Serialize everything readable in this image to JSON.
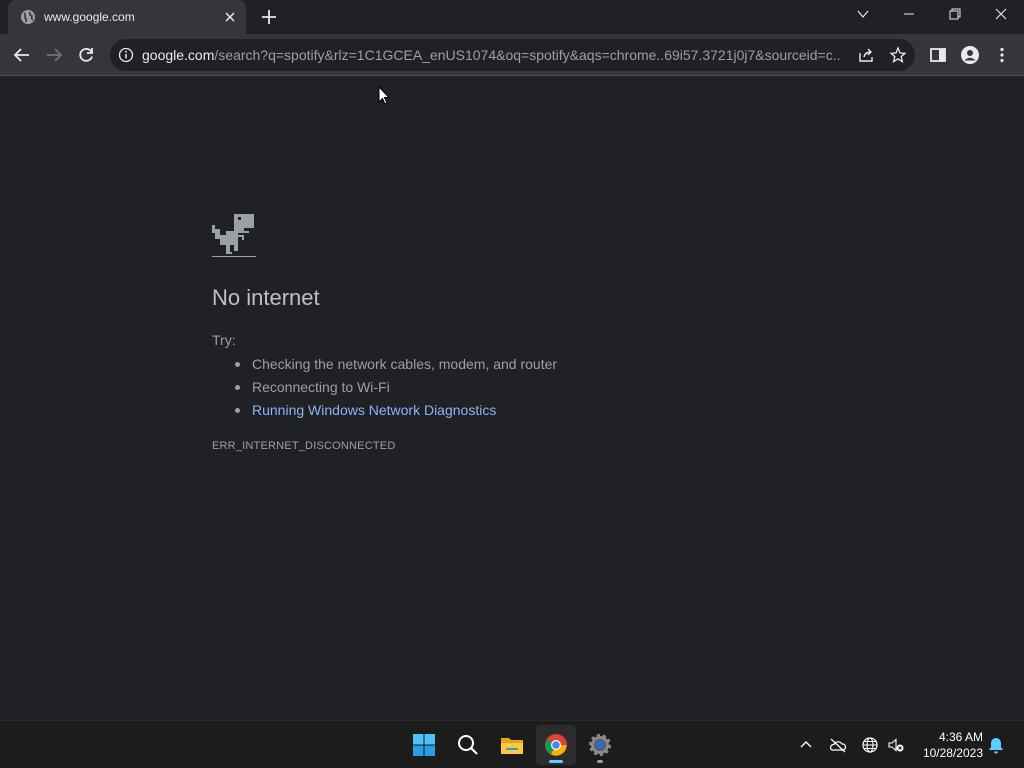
{
  "browser": {
    "tab": {
      "title": "www.google.com"
    },
    "address_bar": {
      "host": "google.com",
      "path": "/search?q=spotify&rlz=1C1GCEA_enUS1074&oq=spotify&aqs=chrome..69i57.3721j0j7&sourceid=c..."
    }
  },
  "error_page": {
    "heading": "No internet",
    "try_label": "Try:",
    "suggestions": [
      "Checking the network cables, modem, and router",
      "Reconnecting to Wi-Fi",
      "Running Windows Network Diagnostics"
    ],
    "error_code": "ERR_INTERNET_DISCONNECTED"
  },
  "taskbar": {
    "apps": [
      "start-icon",
      "search-icon",
      "file-explorer-icon",
      "chrome-icon",
      "settings-icon"
    ],
    "clock": {
      "time": "4:36 AM",
      "date": "10/28/2023"
    }
  },
  "colors": {
    "background": "#202124",
    "toolbar": "#35363a",
    "link": "#8ab4f8",
    "text": "#9aa0a6",
    "accent": "#60cdff"
  }
}
